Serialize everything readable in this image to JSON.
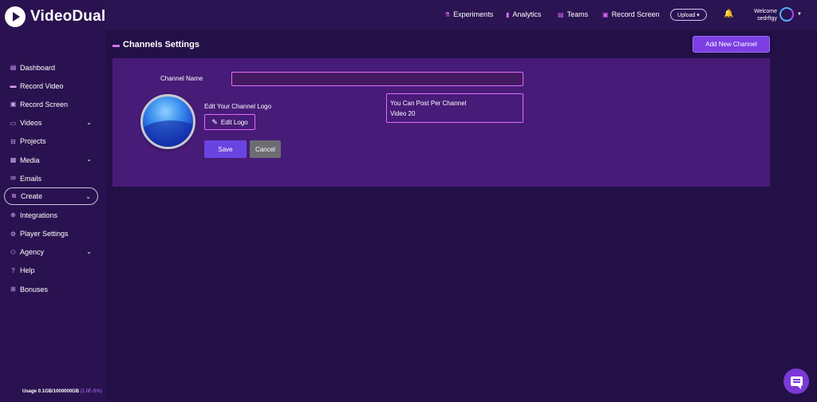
{
  "app": {
    "name": "VideoDual"
  },
  "sidebar": {
    "items": [
      {
        "label": "Dashboard",
        "icon": "dashboard-icon",
        "glyph": "▤"
      },
      {
        "label": "Record Video",
        "icon": "record-video-icon",
        "glyph": "▬"
      },
      {
        "label": "Record Screen",
        "icon": "record-screen-icon",
        "glyph": "▣"
      },
      {
        "label": "Videos",
        "icon": "videos-icon",
        "glyph": "▭",
        "chevron": "⌄"
      },
      {
        "label": "Projects",
        "icon": "projects-icon",
        "glyph": "⊟"
      },
      {
        "label": "Media",
        "icon": "media-icon",
        "glyph": "▦",
        "chevron": "⌄"
      },
      {
        "label": "Emails",
        "icon": "emails-icon",
        "glyph": "✉"
      },
      {
        "label": "Create",
        "icon": "create-icon",
        "glyph": "⧉",
        "chevron": "⌄",
        "active": true
      },
      {
        "label": "Integrations",
        "icon": "integrations-icon",
        "glyph": "⊕"
      },
      {
        "label": "Player Settings",
        "icon": "player-settings-icon",
        "glyph": "⚙"
      },
      {
        "label": "Agency",
        "icon": "agency-icon",
        "glyph": "⚇",
        "chevron": "⌄"
      },
      {
        "label": "Help",
        "icon": "help-icon",
        "glyph": "?"
      },
      {
        "label": "Bonuses",
        "icon": "bonuses-icon",
        "glyph": "⊞"
      }
    ],
    "usage": {
      "text": "Usage 0.1GB/1000000GB",
      "percent": "(1.0E-5%)"
    }
  },
  "topbar": {
    "nav": [
      {
        "label": "Experiments",
        "icon": "experiments-icon",
        "glyph": "⚗"
      },
      {
        "label": "Analytics",
        "icon": "analytics-icon",
        "glyph": "▮"
      },
      {
        "label": "Teams",
        "icon": "teams-icon",
        "glyph": "▤"
      },
      {
        "label": "Record Screen",
        "icon": "record-screen-icon",
        "glyph": "▣"
      }
    ],
    "upload_label": "Upload ▾",
    "welcome": "Welcome",
    "username": "sedrftgy"
  },
  "page": {
    "title": "Channels Settings",
    "add_button": "Add New Channel"
  },
  "form": {
    "channel_name_label": "Channel Name",
    "channel_name_value": "",
    "edit_logo_caption": "Edit Your Channel Logo",
    "edit_logo_button": "Edit Logo",
    "save_button": "Save",
    "cancel_button": "Cancel",
    "info_line1": "You Can Post Per Channel",
    "info_line2": "Video 20"
  },
  "colors": {
    "accent": "#7b3fe4",
    "border_pink": "#e06bff",
    "panel": "#471b78",
    "background": "#231047"
  }
}
